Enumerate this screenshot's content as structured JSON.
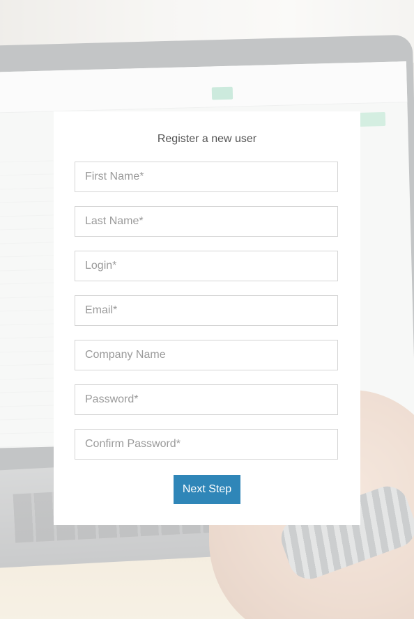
{
  "form": {
    "title": "Register a new user",
    "fields": [
      {
        "name": "first-name-field",
        "placeholder": "First Name*",
        "value": ""
      },
      {
        "name": "last-name-field",
        "placeholder": "Last Name*",
        "value": ""
      },
      {
        "name": "login-field",
        "placeholder": "Login*",
        "value": ""
      },
      {
        "name": "email-field",
        "placeholder": "Email*",
        "value": ""
      },
      {
        "name": "company-name-field",
        "placeholder": "Company Name",
        "value": ""
      },
      {
        "name": "password-field",
        "placeholder": "Password*",
        "value": ""
      },
      {
        "name": "confirm-password-field",
        "placeholder": "Confirm Password*",
        "value": ""
      }
    ],
    "submit_label": "Next Step"
  },
  "colors": {
    "button": "#2f86b8",
    "card": "#ffffff",
    "field_border": "#d4d4d4"
  }
}
